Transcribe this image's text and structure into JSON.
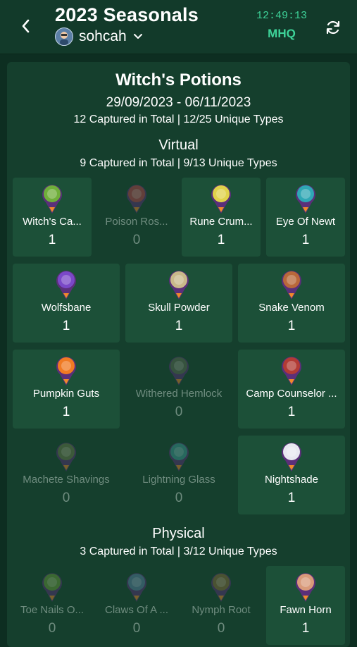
{
  "header": {
    "title": "2023 Seasonals",
    "username": "sohcah",
    "clock": "12:49:13",
    "hq_label": "MHQ"
  },
  "event": {
    "title": "Witch's Potions",
    "dates": "29/09/2023 - 06/11/2023",
    "stats": "12 Captured in Total | 12/25 Unique Types"
  },
  "virtual": {
    "title": "Virtual",
    "stats": "9 Captured in Total | 9/13 Unique Types",
    "items": [
      {
        "name": "Witch's Ca...",
        "count": "1",
        "captured": true,
        "color": "#6fae3a"
      },
      {
        "name": "Poison Ros...",
        "count": "0",
        "captured": false,
        "color": "#c0414a"
      },
      {
        "name": "Rune Crum...",
        "count": "1",
        "captured": true,
        "color": "#e0d24a"
      },
      {
        "name": "Eye Of Newt",
        "count": "1",
        "captured": true,
        "color": "#2fa7b5"
      },
      {
        "name": "Wolfsbane",
        "count": "1",
        "captured": true,
        "color": "#7a48c8"
      },
      {
        "name": "Skull Powder",
        "count": "1",
        "captured": true,
        "color": "#c9b98a"
      },
      {
        "name": "Snake Venom",
        "count": "1",
        "captured": true,
        "color": "#b9683a"
      },
      {
        "name": "Pumpkin Guts",
        "count": "1",
        "captured": true,
        "color": "#f07a23"
      },
      {
        "name": "Withered Hemlock",
        "count": "0",
        "captured": false,
        "color": "#5e6a54"
      },
      {
        "name": "Camp Counselor ...",
        "count": "1",
        "captured": true,
        "color": "#b23b35"
      },
      {
        "name": "Machete Shavings",
        "count": "0",
        "captured": false,
        "color": "#6d7a4a"
      },
      {
        "name": "Lightning Glass",
        "count": "0",
        "captured": false,
        "color": "#3e9a9a"
      },
      {
        "name": "Nightshade",
        "count": "1",
        "captured": true,
        "color": "#e8e8f0"
      }
    ]
  },
  "physical": {
    "title": "Physical",
    "stats": "3 Captured in Total | 3/12 Unique Types",
    "items": [
      {
        "name": "Toe Nails O...",
        "count": "0",
        "captured": false,
        "color": "#6b9a3a"
      },
      {
        "name": "Claws Of A ...",
        "count": "0",
        "captured": false,
        "color": "#5a7fa8"
      },
      {
        "name": "Nymph Root",
        "count": "0",
        "captured": false,
        "color": "#8a6a3a"
      },
      {
        "name": "Fawn Horn",
        "count": "1",
        "captured": true,
        "color": "#d99a7a"
      }
    ]
  }
}
